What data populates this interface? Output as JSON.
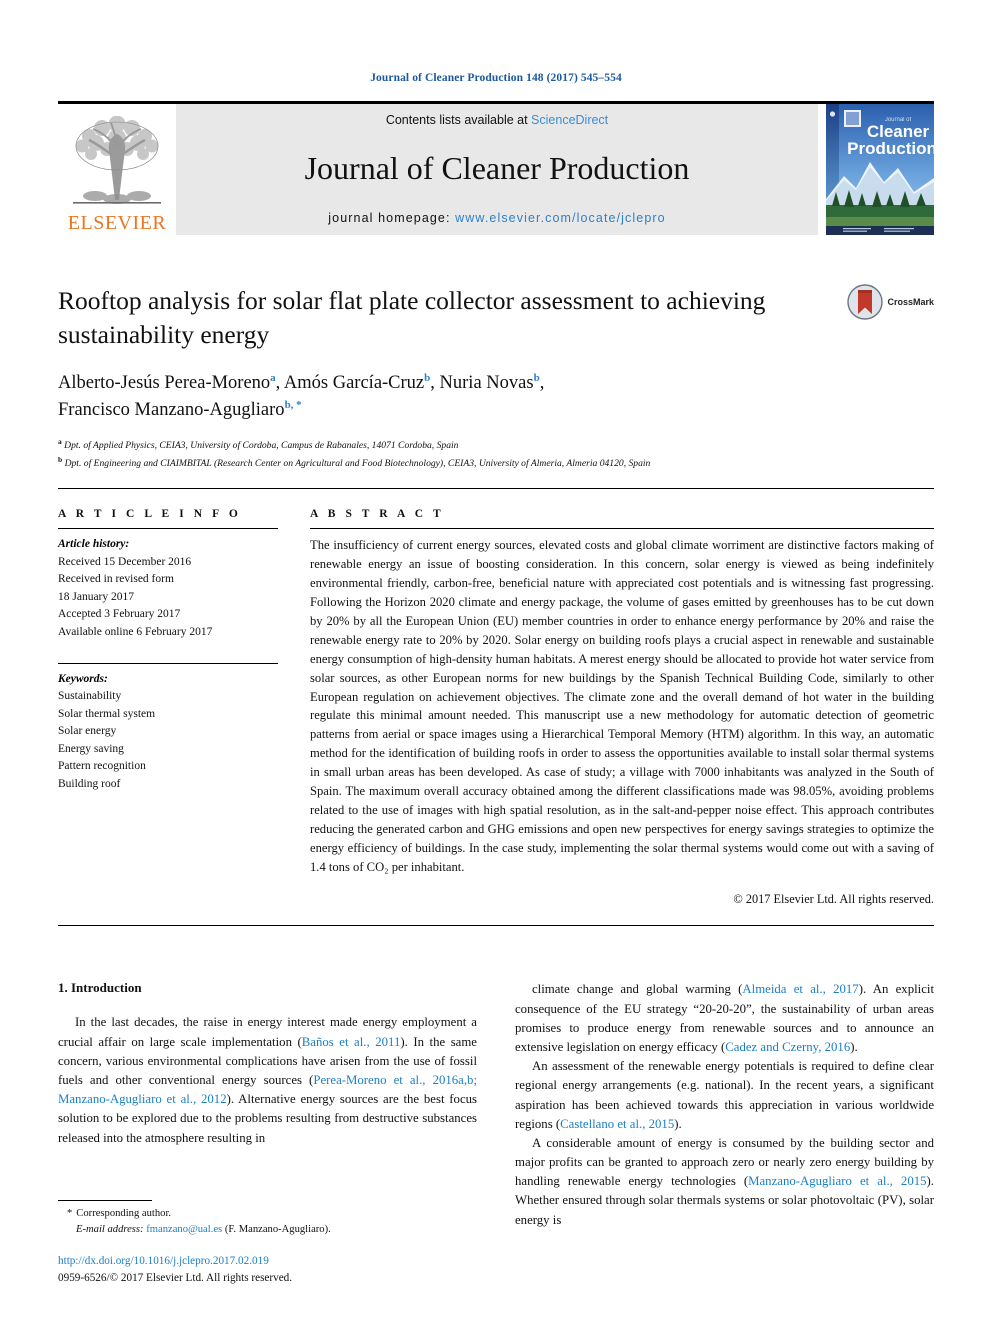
{
  "running_head": "Journal of Cleaner Production 148 (2017) 545–554",
  "masthead": {
    "publisher_logo_label": "ELSEVIER",
    "contents_prefix": "Contents lists available at ",
    "contents_link": "ScienceDirect",
    "journal_title": "Journal of Cleaner Production",
    "homepage_prefix": "journal homepage: ",
    "homepage_url": "www.elsevier.com/locate/jclepro",
    "cover_line1": "Journal of",
    "cover_line2": "Cleaner",
    "cover_line3": "Production"
  },
  "article": {
    "title": "Rooftop analysis for solar flat plate collector assessment to achieving sustainability energy",
    "crossmark_label": "CrossMark",
    "authors_line1": "Alberto-Jesús Perea-Moreno",
    "authors_line1_sup": "a",
    "authors_line1b": "Amós García-Cruz",
    "authors_line1b_sup": "b",
    "authors_line1c": "Nuria Novas",
    "authors_line1c_sup": "b",
    "authors_line2": "Francisco Manzano-Agugliaro",
    "authors_line2_sup": "b, *",
    "affiliation_a_sup": "a",
    "affiliation_a": "Dpt. of Applied Physics, CEIA3, University of Cordoba, Campus de Rabanales, 14071 Cordoba, Spain",
    "affiliation_b_sup": "b",
    "affiliation_b": "Dpt. of Engineering and CIAIMBITAL (Research Center on Agricultural and Food Biotechnology), CEIA3, University of Almeria, Almeria 04120, Spain"
  },
  "article_info": {
    "heading": "A R T I C L E   I N F O",
    "history_label": "Article history:",
    "history_lines": [
      "Received 15 December 2016",
      "Received in revised form",
      "18 January 2017",
      "Accepted 3 February 2017",
      "Available online 6 February 2017"
    ],
    "keywords_label": "Keywords:",
    "keywords": [
      "Sustainability",
      "Solar thermal system",
      "Solar energy",
      "Energy saving",
      "Pattern recognition",
      "Building roof"
    ]
  },
  "abstract": {
    "heading": "A B S T R A C T",
    "text": "The insufficiency of current energy sources, elevated costs and global climate worriment are distinctive factors making of renewable energy an issue of boosting consideration. In this concern, solar energy is viewed as being indefinitely environmental friendly, carbon-free, beneficial nature with appreciated cost potentials and is witnessing fast progressing. Following the Horizon 2020 climate and energy package, the volume of gases emitted by greenhouses has to be cut down by 20% by all the European Union (EU) member countries in order to enhance energy performance by 20% and raise the renewable energy rate to 20% by 2020. Solar energy on building roofs plays a crucial aspect in renewable and sustainable energy consumption of high-density human habitats. A merest energy should be allocated to provide hot water service from solar sources, as other European norms for new buildings by the Spanish Technical Building Code, similarly to other European regulation on achievement objectives. The climate zone and the overall demand of hot water in the building regulate this minimal amount needed. This manuscript use a new methodology for automatic detection of geometric patterns from aerial or space images using a Hierarchical Temporal Memory (HTM) algorithm. In this way, an automatic method for the identification of building roofs in order to assess the opportunities available to install solar thermal systems in small urban areas has been developed. As case of study; a village with 7000 inhabitants was analyzed in the South of Spain. The maximum overall accuracy obtained among the different classifications made was 98.05%, avoiding problems related to the use of images with high spatial resolution, as in the salt-and-pepper noise effect. This approach contributes reducing the generated carbon and GHG emissions and open new perspectives for energy savings strategies to optimize the energy efficiency of buildings. In the case study, implementing the solar thermal systems would come out with a saving of 1.4 tons of CO₂ per inhabitant.",
    "copyright": "© 2017 Elsevier Ltd. All rights reserved."
  },
  "introduction": {
    "section_number_title": "1. Introduction",
    "left_paragraph_html": "In the last decades, the raise in energy interest made energy employment a crucial affair on large scale implementation (<span class=\"ref\">Baños et al., 2011</span>). In the same concern, various environmental complications have arisen from the use of fossil fuels and other conventional energy sources (<span class=\"ref\">Perea-Moreno et al., 2016a,b; Manzano-Agugliaro et al., 2012</span>). Alternative energy sources are the best focus solution to be explored due to the problems resulting from destructive substances released into the atmosphere resulting in",
    "right_paragraph_1_html": "climate change and global warming (<span class=\"ref\">Almeida et al., 2017</span>). An explicit consequence of the EU strategy “20-20-20”, the sustainability of urban areas promises to produce energy from renewable sources and to announce an extensive legislation on energy efficacy (<span class=\"ref\">Cadez and Czerny, 2016</span>).",
    "right_paragraph_2_html": "An assessment of the renewable energy potentials is required to define clear regional energy arrangements (e.g. national). In the recent years, a significant aspiration has been achieved towards this appreciation in various worldwide regions (<span class=\"ref\">Castellano et al., 2015</span>).",
    "right_paragraph_3_html": "A considerable amount of energy is consumed by the building sector and major profits can be granted to approach zero or nearly zero energy building by handling renewable energy technologies (<span class=\"ref\">Manzano-Agugliaro et al., 2015</span>). Whether ensured through solar thermals systems or solar photovoltaic (PV), solar energy is"
  },
  "footnote": {
    "star": "*",
    "corresponding": "Corresponding author.",
    "email_label": "E-mail address:",
    "email": "fmanzano@ual.es",
    "email_owner": "(F. Manzano-Agugliaro).",
    "doi": "http://dx.doi.org/10.1016/j.jclepro.2017.02.019",
    "issn_line": "0959-6526/© 2017 Elsevier Ltd. All rights reserved."
  },
  "colors": {
    "link_blue": "#1b7fc4",
    "running_head_blue": "#1b5a9e",
    "elsevier_orange": "#E87722",
    "masthead_grey": "#e8e8e8"
  }
}
